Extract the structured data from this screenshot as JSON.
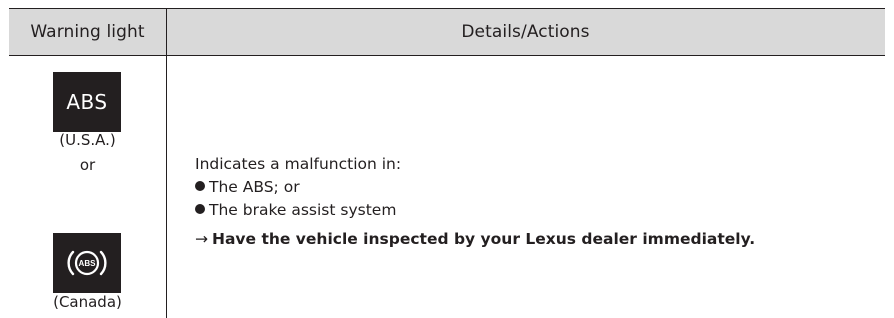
{
  "table": {
    "headers": {
      "col1": "Warning light",
      "col2": "Details/Actions"
    },
    "row": {
      "indicator": {
        "usa_badge_text": "ABS",
        "usa_caption": "(U.S.A.)",
        "or_text": "or",
        "canada_icon_text": "ABS",
        "canada_caption": "(Canada)"
      },
      "details": {
        "intro": "Indicates a malfunction in:",
        "bullets": [
          "The ABS; or",
          "The brake assist system"
        ],
        "action": "Have the vehicle inspected by your Lexus dealer immediately."
      }
    }
  },
  "icons": {
    "bullet": "filled-circle-bullet",
    "arrow": "right-arrow",
    "canada_warning": "abs-circle-warning-icon"
  },
  "colors": {
    "header_background": "#d9d9d9",
    "ink": "#231f20",
    "badge_text": "#ffffff"
  }
}
